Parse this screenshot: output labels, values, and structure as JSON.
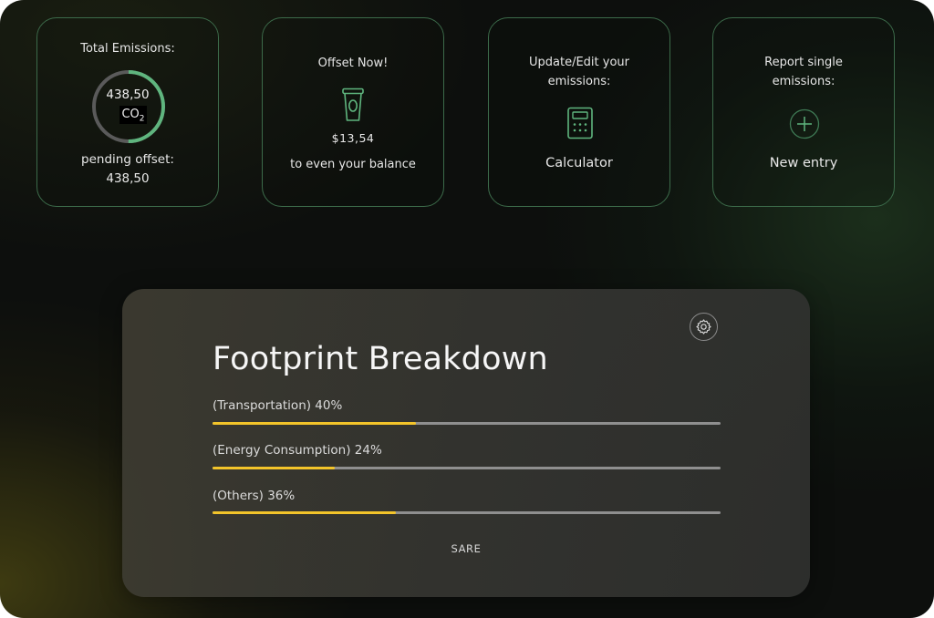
{
  "colors": {
    "accent_green": "#5fb57e",
    "ring_track": "#5a5a5a",
    "bar_fill": "#f3c42a",
    "bar_track": "#8f8f8f"
  },
  "emissions_card": {
    "title": "Total Emissions:",
    "value": "438,50",
    "unit": "CO",
    "unit_sub": "2",
    "progress": 0.5,
    "pending_label": "pending offset:",
    "pending_value": "438,50"
  },
  "offset_card": {
    "title": "Offset Now!",
    "icon": "coffee-cup-icon",
    "price": "$13,54",
    "subtitle": "to even your balance"
  },
  "calculator_card": {
    "title": "Update/Edit your\nemissions:",
    "icon": "calculator-icon",
    "action": "Calculator"
  },
  "report_card": {
    "title": "Report single\nemissions:",
    "icon": "plus-circle-icon",
    "action": "New entry"
  },
  "breakdown": {
    "title": "Footprint Breakdown",
    "items": [
      {
        "label": "(Transportation) 40%",
        "value": 0.4
      },
      {
        "label": "(Energy Consumption) 24%",
        "value": 0.24
      },
      {
        "label": "(Others) 36%",
        "value": 0.36
      }
    ],
    "save_label": "SARE",
    "settings_icon": "gear-icon"
  }
}
